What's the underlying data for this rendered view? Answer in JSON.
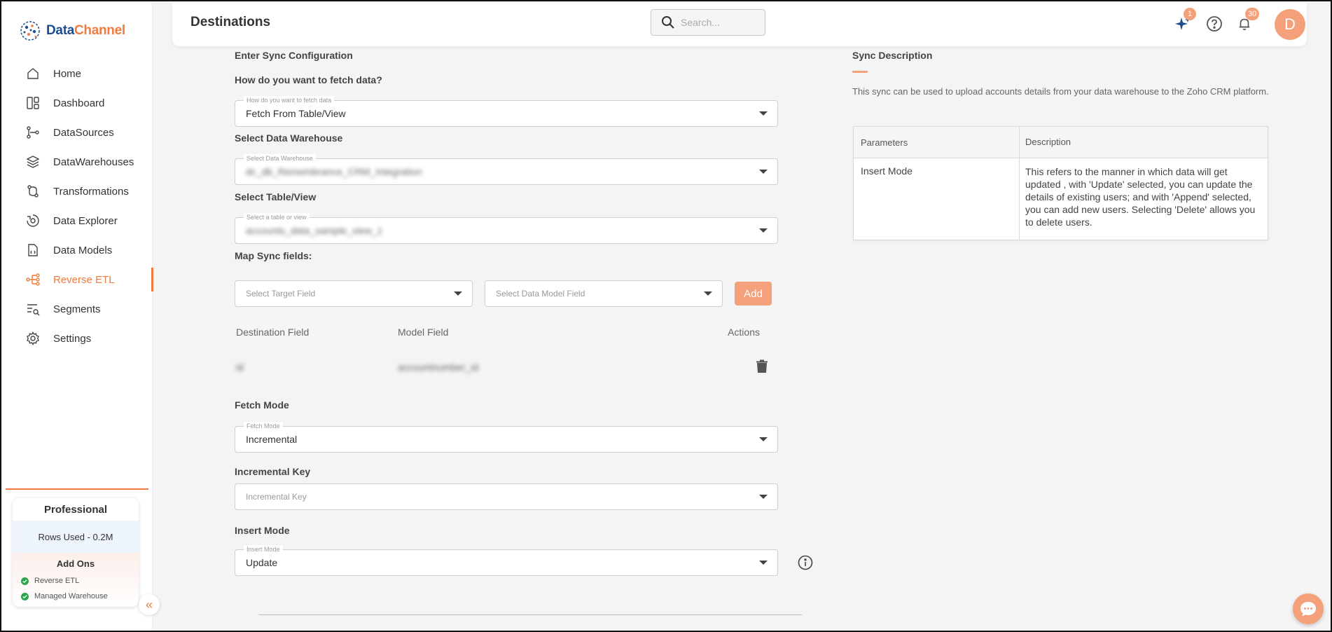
{
  "brand": {
    "name_part1": "Data",
    "name_part2": "Channel"
  },
  "nav": {
    "items": [
      {
        "label": "Home",
        "icon": "home-icon"
      },
      {
        "label": "Dashboard",
        "icon": "dashboard-icon"
      },
      {
        "label": "DataSources",
        "icon": "datasources-icon"
      },
      {
        "label": "DataWarehouses",
        "icon": "layers-icon"
      },
      {
        "label": "Transformations",
        "icon": "transformations-icon"
      },
      {
        "label": "Data Explorer",
        "icon": "explorer-icon"
      },
      {
        "label": "Data Models",
        "icon": "data-models-icon"
      },
      {
        "label": "Reverse ETL",
        "icon": "reverse-etl-icon",
        "active": true
      },
      {
        "label": "Segments",
        "icon": "segments-icon"
      },
      {
        "label": "Settings",
        "icon": "gear-icon"
      }
    ]
  },
  "plan": {
    "name": "Professional",
    "rows_used": "Rows Used - 0.2M",
    "addons_title": "Add Ons",
    "addons": [
      "Reverse ETL",
      "Managed Warehouse"
    ]
  },
  "header": {
    "title": "Destinations",
    "search_placeholder": "Search...",
    "sparkle_badge": "1",
    "notifications_badge": "30",
    "avatar_initial": "D"
  },
  "form": {
    "section_title": "Enter Sync Configuration",
    "fetch_label": "How do you want to fetch data?",
    "fetch_legend": "How do you want to fetch data",
    "fetch_value": "Fetch From Table/View",
    "warehouse_label": "Select Data Warehouse",
    "warehouse_legend": "Select Data Warehouse",
    "warehouse_value": "dc_db_Remembrance_CRM_Integration",
    "table_label": "Select Table/View",
    "table_legend": "Select a table or view",
    "table_value": "accounts_data_sample_view_1",
    "map_label": "Map Sync fields:",
    "target_field_placeholder": "Select Target Field",
    "model_field_placeholder": "Select Data Model Field",
    "add_label": "Add",
    "map_headers": {
      "destination": "Destination Field",
      "model": "Model Field",
      "actions": "Actions"
    },
    "map_rows": [
      {
        "destination": "id",
        "model": "accountnumber_id"
      }
    ],
    "fetch_mode_label": "Fetch Mode",
    "fetch_mode_legend": "Fetch Mode",
    "fetch_mode_value": "Incremental",
    "incremental_key_label": "Incremental Key",
    "incremental_key_placeholder": "Incremental Key",
    "insert_mode_label": "Insert Mode",
    "insert_mode_legend": "Insert Mode",
    "insert_mode_value": "Update"
  },
  "sync_description": {
    "title": "Sync Description",
    "text": "This sync can be used to upload accounts details from your data warehouse to the Zoho CRM platform.",
    "headers": {
      "parameters": "Parameters",
      "description": "Description"
    },
    "rows": [
      {
        "parameter": "Insert Mode",
        "description": "This refers to the manner in which data will get updated , with 'Update' selected, you can update the details of existing users; and with 'Append' selected, you can add new users. Selecting 'Delete' allows you to delete users."
      }
    ]
  },
  "colors": {
    "accent": "#f07b3f",
    "accent_light": "#f4a07a",
    "brand_blue": "#1e4d8f",
    "success": "#2ea44f"
  }
}
